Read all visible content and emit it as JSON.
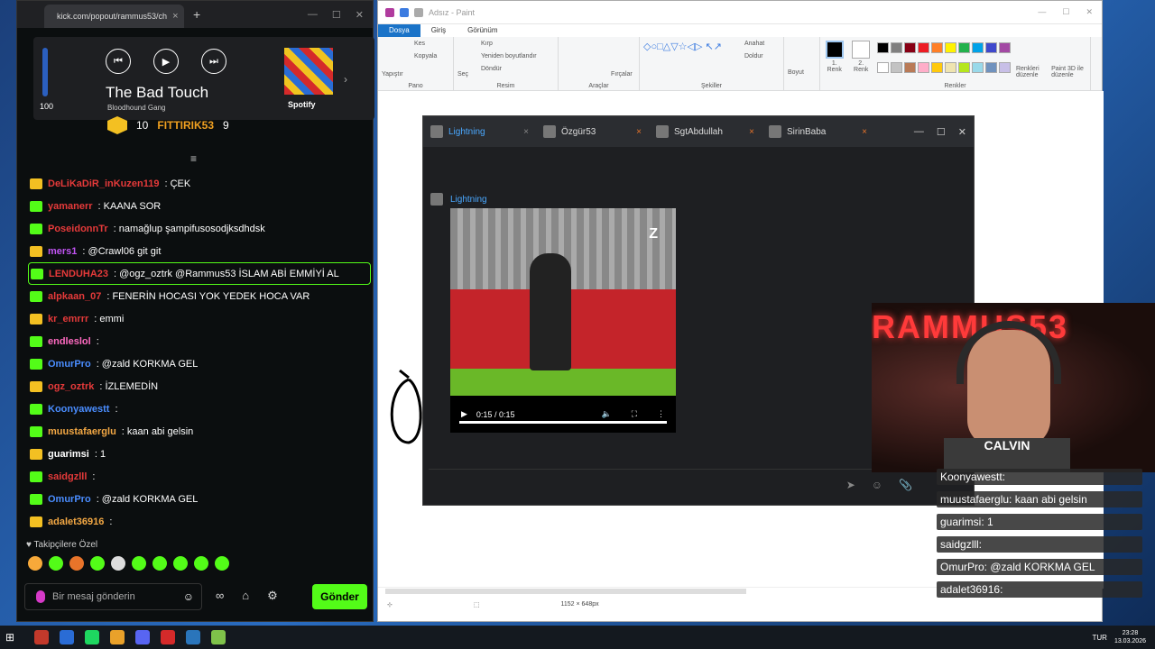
{
  "browser": {
    "tab_title": "kick.com/popout/rammus53/ch",
    "media": {
      "song": "The Bad Touch",
      "artist": "Bloodhound Gang",
      "volume": "100",
      "spotify": "Spotify"
    },
    "leaderboard": [
      {
        "count": "10"
      },
      {
        "name": "FITTIRIK53",
        "count": "9"
      }
    ],
    "chat": [
      {
        "user": "DeLiKaDiR_inKuzen119",
        "text": ": ÇEK",
        "color": "#e63a3a"
      },
      {
        "user": "yamanerr",
        "text": ": KAANA SOR",
        "color": "#e63a3a"
      },
      {
        "user": "PoseidonnTr",
        "text": ": namağlup şampifusosodjksdhdsk",
        "color": "#e63a3a"
      },
      {
        "user": "mers1",
        "text": ": @Crawl06 git git",
        "color": "#c154f3"
      },
      {
        "user": "LENDUHA23",
        "text": ": @ogz_oztrk @Rammus53 İSLAM ABİ EMMİYİ AL",
        "color": "#e63a3a",
        "highlight": true
      },
      {
        "user": "alpkaan_07",
        "text": ": FENERİN HOCASI YOK YEDEK HOCA VAR",
        "color": "#e63a3a"
      },
      {
        "user": "kr_emrrr",
        "text": ": emmi",
        "color": "#e63a3a"
      },
      {
        "user": "endleslol",
        "text": ":",
        "color": "#ff6ac1"
      },
      {
        "user": "OmurPro",
        "text": ": @zald KORKMA GEL",
        "color": "#4a8dff"
      },
      {
        "user": "ogz_oztrk",
        "text": ": İZLEMEDİN",
        "color": "#e63a3a"
      },
      {
        "user": "Koonyawestt",
        "text": ":",
        "color": "#4a8dff"
      },
      {
        "user": "muustafaerglu",
        "text": ": kaan abi gelsin",
        "color": "#f3a844"
      },
      {
        "user": "guarimsi",
        "text": ": 1",
        "color": "#ffffff"
      },
      {
        "user": "saidgzlll",
        "text": ":",
        "color": "#e63a3a"
      },
      {
        "user": "OmurPro",
        "text": ": @zald KORKMA GEL",
        "color": "#4a8dff"
      },
      {
        "user": "adalet36916",
        "text": ":",
        "color": "#f3a844"
      }
    ],
    "followers_only": "Takipçilere Özel",
    "input_placeholder": "Bir mesaj gönderin",
    "send_label": "Gönder"
  },
  "paint": {
    "title": "Adsız - Paint",
    "menus": [
      "Dosya",
      "Giriş",
      "Görünüm"
    ],
    "ribbon": {
      "paste": "Yapıştır",
      "cut": "Kes",
      "copy": "Kopyala",
      "select": "Seç",
      "crop": "Kırp",
      "resize": "Yeniden boyutlandır",
      "rotate": "Döndür",
      "brushes": "Fırçalar",
      "outline": "Anahat",
      "fill": "Doldur",
      "size": "Boyut",
      "color1": "1. Renk",
      "color2": "2. Renk",
      "edit_colors": "Renkleri düzenle",
      "paint3d": "Paint 3D ile düzenle",
      "groups": [
        "Pano",
        "Resim",
        "Araçlar",
        "Şekiller",
        "Renkler"
      ]
    },
    "palette": [
      "#000000",
      "#7f7f7f",
      "#880015",
      "#ed1c24",
      "#ff7f27",
      "#fff200",
      "#22b14c",
      "#00a2e8",
      "#3f48cc",
      "#a349a4",
      "#ffffff",
      "#c3c3c3",
      "#b97a57",
      "#ffaec9",
      "#ffc90e",
      "#efe4b0",
      "#b5e61d",
      "#99d9ea",
      "#7092be",
      "#c8bfe7"
    ],
    "status_size": "1152 × 648px"
  },
  "dm": {
    "tabs": [
      "Lightning",
      "Özgür53",
      "SgtAbdullah",
      "SirinBaba"
    ],
    "author": "Lightning",
    "video_time": "0:15 / 0:15"
  },
  "overlay": {
    "lines": [
      "Koonyawestt:",
      "muustafaerglu: kaan abi gelsin",
      "guarimsi: 1",
      "saidgzlll:",
      "OmurPro: @zald KORKMA GEL",
      "adalet36916:"
    ],
    "webcam_text": "RAMMUS53",
    "shirt_text": "CALVIN"
  },
  "taskbar": {
    "lang": "TUR",
    "time": "23:28",
    "date": "13.03.2026"
  }
}
